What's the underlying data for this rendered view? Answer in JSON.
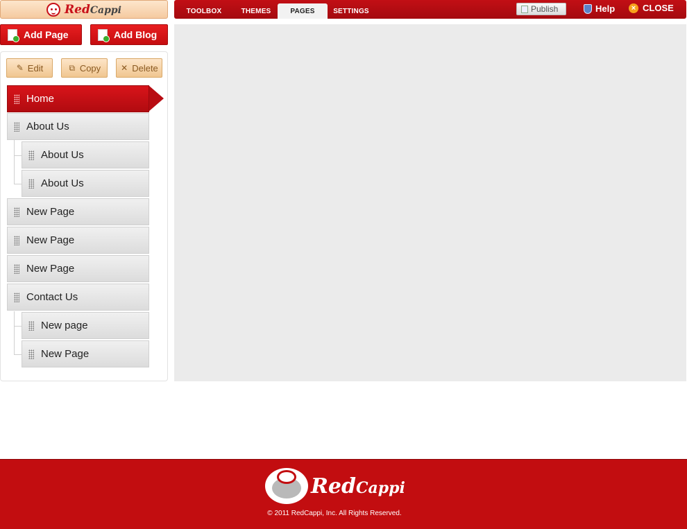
{
  "app": {
    "brand_primary": "Red",
    "brand_secondary": "Cappi"
  },
  "topnav": {
    "tabs": [
      {
        "label": "TOOLBOX"
      },
      {
        "label": "THEMES"
      },
      {
        "label": "PAGES",
        "active": true
      },
      {
        "label": "SETTINGS"
      }
    ],
    "publish_label": "Publish",
    "help_label": "Help",
    "close_label": "CLOSE"
  },
  "actions": {
    "add_page": "Add Page",
    "add_blog": "Add Blog"
  },
  "toolbar": {
    "edit": "Edit",
    "copy": "Copy",
    "delete": "Delete"
  },
  "pages": [
    {
      "label": "Home",
      "level": 0,
      "active": true
    },
    {
      "label": "About Us",
      "level": 0
    },
    {
      "label": "About Us",
      "level": 1
    },
    {
      "label": "About Us",
      "level": 1
    },
    {
      "label": "New Page",
      "level": 0
    },
    {
      "label": "New Page",
      "level": 0
    },
    {
      "label": "New Page",
      "level": 0
    },
    {
      "label": "Contact Us",
      "level": 0
    },
    {
      "label": "New page",
      "level": 1
    },
    {
      "label": "New Page",
      "level": 1
    }
  ],
  "footer": {
    "brand_primary": "Red",
    "brand_secondary": "Cappi",
    "copyright": "© 2011 RedCappi, Inc. All Rights Reserved."
  },
  "colors": {
    "brand_red": "#c20f15",
    "canvas_gray": "#ebebeb",
    "tool_button": "#f0c690"
  },
  "icons": [
    "monkey-face-icon",
    "page-add-icon",
    "blog-add-icon",
    "pencil-icon",
    "copy-icon",
    "x-icon",
    "grip-icon",
    "shield-icon",
    "close-circle-icon",
    "document-icon"
  ]
}
